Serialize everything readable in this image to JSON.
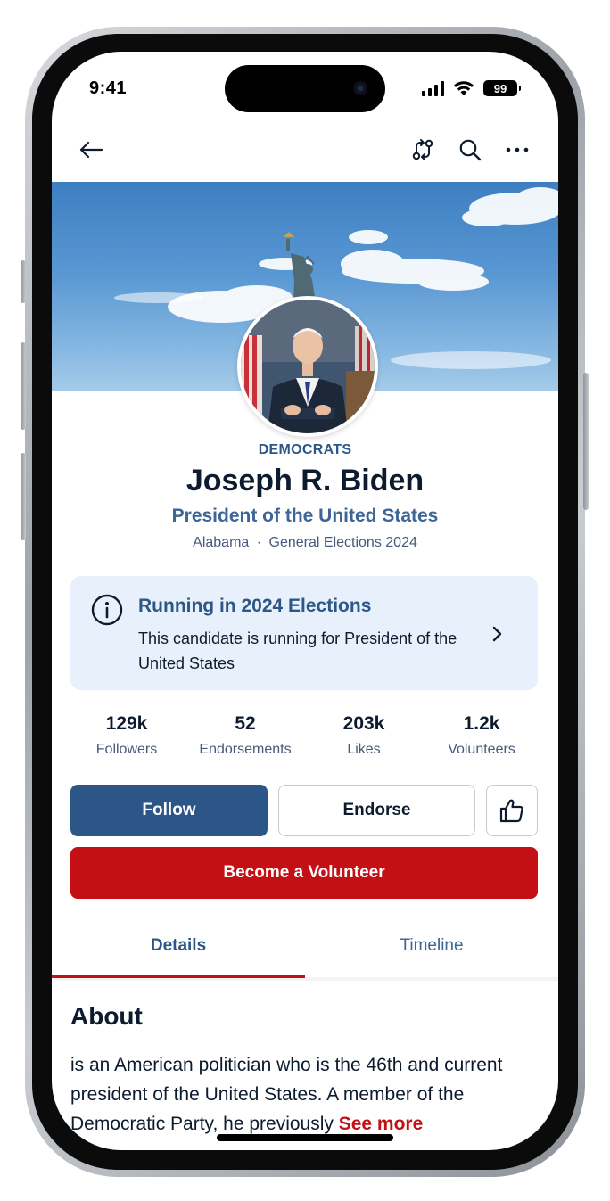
{
  "status_bar": {
    "time": "9:41",
    "battery": "99"
  },
  "candidate": {
    "party": "DEMOCRATS",
    "name": "Joseph R. Biden",
    "office": "President of the United States",
    "state": "Alabama",
    "separator": "·",
    "election": "General Elections 2024"
  },
  "notice": {
    "title": "Running in 2024 Elections",
    "body": "This candidate is running for President of the United States"
  },
  "stats": [
    {
      "value": "129k",
      "label": "Followers"
    },
    {
      "value": "52",
      "label": "Endorsements"
    },
    {
      "value": "203k",
      "label": "Likes"
    },
    {
      "value": "1.2k",
      "label": "Volunteers"
    }
  ],
  "actions": {
    "follow": "Follow",
    "endorse": "Endorse",
    "volunteer": "Become a Volunteer"
  },
  "tabs": [
    {
      "label": "Details",
      "active": true
    },
    {
      "label": "Timeline",
      "active": false
    }
  ],
  "about": {
    "title": "About",
    "text": "is an American politician who is the 46th and current president of the United States. A member of the Democratic Party, he previously",
    "see_more": "See more"
  },
  "colors": {
    "primary_blue": "#2c5588",
    "accent_red": "#c41015",
    "info_bg": "#e8f0fb",
    "text_dark": "#0d1b2e"
  },
  "icons": [
    "back-arrow-icon",
    "share-swap-icon",
    "search-icon",
    "more-icon",
    "info-icon",
    "chevron-right-icon",
    "thumbs-up-icon"
  ]
}
